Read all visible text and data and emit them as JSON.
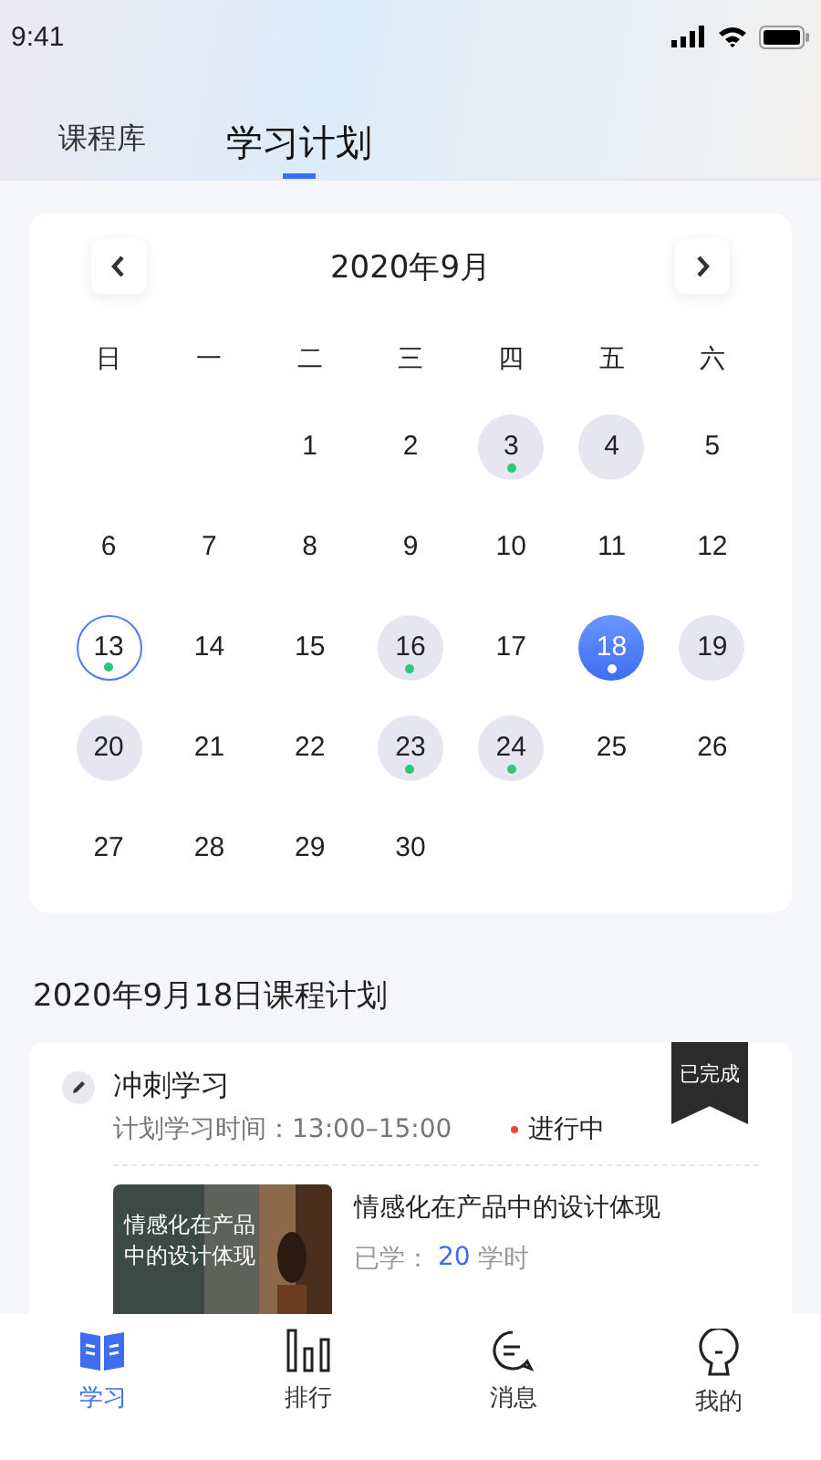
{
  "status_bar": {
    "time": "9:41"
  },
  "tabs": [
    {
      "label": "课程库",
      "selected": false
    },
    {
      "label": "学习计划",
      "selected": true
    }
  ],
  "calendar": {
    "month": "2020年9月",
    "weekdays": [
      "日",
      "一",
      "二",
      "三",
      "四",
      "五",
      "六"
    ],
    "weeks": [
      {
        "days": [
          {
            "kind": "blank"
          },
          {
            "kind": "blank"
          },
          {
            "kind": "day",
            "day": "1",
            "planned": false,
            "dot": false,
            "today": false,
            "selected": false
          },
          {
            "kind": "day",
            "day": "2",
            "planned": false,
            "dot": false,
            "today": false,
            "selected": false
          },
          {
            "kind": "day",
            "day": "3",
            "planned": true,
            "dot": true,
            "today": false,
            "selected": false
          },
          {
            "kind": "day",
            "day": "4",
            "planned": true,
            "dot": false,
            "today": false,
            "selected": false
          },
          {
            "kind": "day",
            "day": "5",
            "planned": false,
            "dot": false,
            "today": false,
            "selected": false
          }
        ]
      },
      {
        "days": [
          {
            "kind": "day",
            "day": "6",
            "planned": false,
            "dot": false,
            "today": false,
            "selected": false
          },
          {
            "kind": "day",
            "day": "7",
            "planned": false,
            "dot": false,
            "today": false,
            "selected": false
          },
          {
            "kind": "day",
            "day": "8",
            "planned": false,
            "dot": false,
            "today": false,
            "selected": false
          },
          {
            "kind": "day",
            "day": "9",
            "planned": false,
            "dot": false,
            "today": false,
            "selected": false
          },
          {
            "kind": "day",
            "day": "10",
            "planned": false,
            "dot": false,
            "today": false,
            "selected": false
          },
          {
            "kind": "day",
            "day": "11",
            "planned": false,
            "dot": false,
            "today": false,
            "selected": false
          },
          {
            "kind": "day",
            "day": "12",
            "planned": false,
            "dot": false,
            "today": false,
            "selected": false
          }
        ]
      },
      {
        "days": [
          {
            "kind": "day",
            "day": "13",
            "planned": false,
            "dot": true,
            "today": true,
            "selected": false
          },
          {
            "kind": "day",
            "day": "14",
            "planned": false,
            "dot": false,
            "today": false,
            "selected": false
          },
          {
            "kind": "day",
            "day": "15",
            "planned": false,
            "dot": false,
            "today": false,
            "selected": false
          },
          {
            "kind": "day",
            "day": "16",
            "planned": true,
            "dot": true,
            "today": false,
            "selected": false
          },
          {
            "kind": "day",
            "day": "17",
            "planned": false,
            "dot": false,
            "today": false,
            "selected": false
          },
          {
            "kind": "day",
            "day": "18",
            "planned": false,
            "dot": true,
            "today": false,
            "selected": true
          },
          {
            "kind": "day",
            "day": "19",
            "planned": true,
            "dot": false,
            "today": false,
            "selected": false
          }
        ]
      },
      {
        "days": [
          {
            "kind": "day",
            "day": "20",
            "planned": true,
            "dot": false,
            "today": false,
            "selected": false
          },
          {
            "kind": "day",
            "day": "21",
            "planned": false,
            "dot": false,
            "today": false,
            "selected": false
          },
          {
            "kind": "day",
            "day": "22",
            "planned": false,
            "dot": false,
            "today": false,
            "selected": false
          },
          {
            "kind": "day",
            "day": "23",
            "planned": true,
            "dot": true,
            "today": false,
            "selected": false
          },
          {
            "kind": "day",
            "day": "24",
            "planned": true,
            "dot": true,
            "today": false,
            "selected": false
          },
          {
            "kind": "day",
            "day": "25",
            "planned": false,
            "dot": false,
            "today": false,
            "selected": false
          },
          {
            "kind": "day",
            "day": "26",
            "planned": false,
            "dot": false,
            "today": false,
            "selected": false
          }
        ]
      },
      {
        "days": [
          {
            "kind": "day",
            "day": "27",
            "planned": false,
            "dot": false,
            "today": false,
            "selected": false
          },
          {
            "kind": "day",
            "day": "28",
            "planned": false,
            "dot": false,
            "today": false,
            "selected": false
          },
          {
            "kind": "day",
            "day": "29",
            "planned": false,
            "dot": false,
            "today": false,
            "selected": false
          },
          {
            "kind": "day",
            "day": "30",
            "planned": false,
            "dot": false,
            "today": false,
            "selected": false
          },
          {
            "kind": "blank"
          },
          {
            "kind": "blank"
          },
          {
            "kind": "blank"
          }
        ]
      }
    ]
  },
  "plan": {
    "heading": "2020年9月18日课程计划",
    "title": "冲刺学习",
    "badge": "已完成",
    "time": "计划学习时间：13:00–15:00",
    "status": "进行中",
    "course": {
      "cover_title": "情感化在产品中的设计体现",
      "title": "情感化在产品中的设计体现",
      "studied_label": "已学：",
      "studied_value": "20",
      "studied_unit": "学时"
    }
  },
  "nav": [
    {
      "label": "学习",
      "selected": true
    },
    {
      "label": "排行",
      "selected": false
    },
    {
      "label": "消息",
      "selected": false
    },
    {
      "label": "我的",
      "selected": false
    }
  ]
}
